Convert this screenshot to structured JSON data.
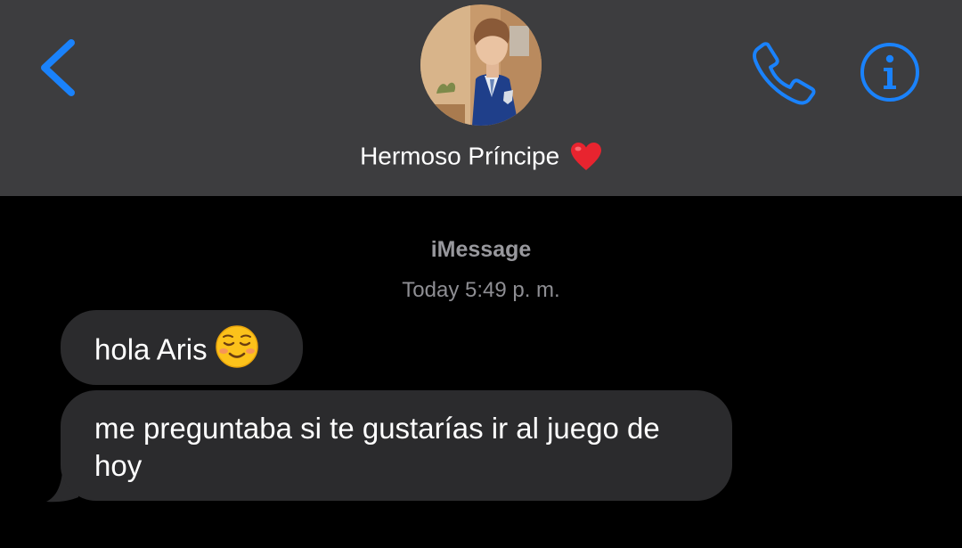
{
  "header": {
    "contact_name": "Hermoso Príncipe",
    "back_icon": "chevron-left-icon",
    "call_icon": "phone-icon",
    "info_icon": "info-icon",
    "heart_icon": "red-heart-emoji",
    "accent_color": "#1a82fb",
    "background_color": "#3d3d3f"
  },
  "conversation": {
    "service_label": "iMessage",
    "timestamp": "Today 5:49 p. m.",
    "messages": [
      {
        "text": "hola Aris",
        "emoji": "smiling-face-emoji",
        "direction": "incoming"
      },
      {
        "text": "me preguntaba si te gustarías ir al juego de hoy",
        "direction": "incoming"
      }
    ],
    "bubble_color": "#2b2b2d"
  }
}
